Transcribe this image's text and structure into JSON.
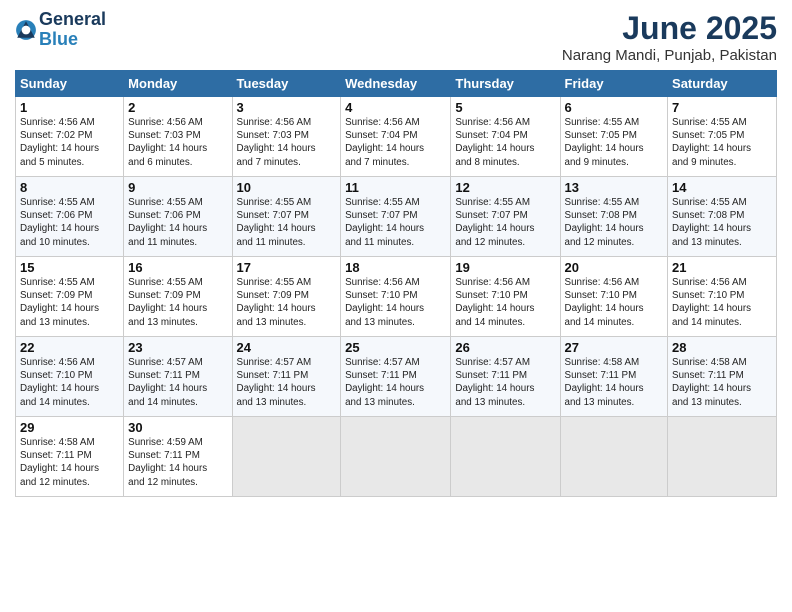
{
  "logo": {
    "line1": "General",
    "line2": "Blue"
  },
  "title": "June 2025",
  "subtitle": "Narang Mandi, Punjab, Pakistan",
  "header_days": [
    "Sunday",
    "Monday",
    "Tuesday",
    "Wednesday",
    "Thursday",
    "Friday",
    "Saturday"
  ],
  "weeks": [
    [
      {
        "day": "1",
        "text": "Sunrise: 4:56 AM\nSunset: 7:02 PM\nDaylight: 14 hours\nand 5 minutes."
      },
      {
        "day": "2",
        "text": "Sunrise: 4:56 AM\nSunset: 7:03 PM\nDaylight: 14 hours\nand 6 minutes."
      },
      {
        "day": "3",
        "text": "Sunrise: 4:56 AM\nSunset: 7:03 PM\nDaylight: 14 hours\nand 7 minutes."
      },
      {
        "day": "4",
        "text": "Sunrise: 4:56 AM\nSunset: 7:04 PM\nDaylight: 14 hours\nand 7 minutes."
      },
      {
        "day": "5",
        "text": "Sunrise: 4:56 AM\nSunset: 7:04 PM\nDaylight: 14 hours\nand 8 minutes."
      },
      {
        "day": "6",
        "text": "Sunrise: 4:55 AM\nSunset: 7:05 PM\nDaylight: 14 hours\nand 9 minutes."
      },
      {
        "day": "7",
        "text": "Sunrise: 4:55 AM\nSunset: 7:05 PM\nDaylight: 14 hours\nand 9 minutes."
      }
    ],
    [
      {
        "day": "8",
        "text": "Sunrise: 4:55 AM\nSunset: 7:06 PM\nDaylight: 14 hours\nand 10 minutes."
      },
      {
        "day": "9",
        "text": "Sunrise: 4:55 AM\nSunset: 7:06 PM\nDaylight: 14 hours\nand 11 minutes."
      },
      {
        "day": "10",
        "text": "Sunrise: 4:55 AM\nSunset: 7:07 PM\nDaylight: 14 hours\nand 11 minutes."
      },
      {
        "day": "11",
        "text": "Sunrise: 4:55 AM\nSunset: 7:07 PM\nDaylight: 14 hours\nand 11 minutes."
      },
      {
        "day": "12",
        "text": "Sunrise: 4:55 AM\nSunset: 7:07 PM\nDaylight: 14 hours\nand 12 minutes."
      },
      {
        "day": "13",
        "text": "Sunrise: 4:55 AM\nSunset: 7:08 PM\nDaylight: 14 hours\nand 12 minutes."
      },
      {
        "day": "14",
        "text": "Sunrise: 4:55 AM\nSunset: 7:08 PM\nDaylight: 14 hours\nand 13 minutes."
      }
    ],
    [
      {
        "day": "15",
        "text": "Sunrise: 4:55 AM\nSunset: 7:09 PM\nDaylight: 14 hours\nand 13 minutes."
      },
      {
        "day": "16",
        "text": "Sunrise: 4:55 AM\nSunset: 7:09 PM\nDaylight: 14 hours\nand 13 minutes."
      },
      {
        "day": "17",
        "text": "Sunrise: 4:55 AM\nSunset: 7:09 PM\nDaylight: 14 hours\nand 13 minutes."
      },
      {
        "day": "18",
        "text": "Sunrise: 4:56 AM\nSunset: 7:10 PM\nDaylight: 14 hours\nand 13 minutes."
      },
      {
        "day": "19",
        "text": "Sunrise: 4:56 AM\nSunset: 7:10 PM\nDaylight: 14 hours\nand 14 minutes."
      },
      {
        "day": "20",
        "text": "Sunrise: 4:56 AM\nSunset: 7:10 PM\nDaylight: 14 hours\nand 14 minutes."
      },
      {
        "day": "21",
        "text": "Sunrise: 4:56 AM\nSunset: 7:10 PM\nDaylight: 14 hours\nand 14 minutes."
      }
    ],
    [
      {
        "day": "22",
        "text": "Sunrise: 4:56 AM\nSunset: 7:10 PM\nDaylight: 14 hours\nand 14 minutes."
      },
      {
        "day": "23",
        "text": "Sunrise: 4:57 AM\nSunset: 7:11 PM\nDaylight: 14 hours\nand 14 minutes."
      },
      {
        "day": "24",
        "text": "Sunrise: 4:57 AM\nSunset: 7:11 PM\nDaylight: 14 hours\nand 13 minutes."
      },
      {
        "day": "25",
        "text": "Sunrise: 4:57 AM\nSunset: 7:11 PM\nDaylight: 14 hours\nand 13 minutes."
      },
      {
        "day": "26",
        "text": "Sunrise: 4:57 AM\nSunset: 7:11 PM\nDaylight: 14 hours\nand 13 minutes."
      },
      {
        "day": "27",
        "text": "Sunrise: 4:58 AM\nSunset: 7:11 PM\nDaylight: 14 hours\nand 13 minutes."
      },
      {
        "day": "28",
        "text": "Sunrise: 4:58 AM\nSunset: 7:11 PM\nDaylight: 14 hours\nand 13 minutes."
      }
    ],
    [
      {
        "day": "29",
        "text": "Sunrise: 4:58 AM\nSunset: 7:11 PM\nDaylight: 14 hours\nand 12 minutes."
      },
      {
        "day": "30",
        "text": "Sunrise: 4:59 AM\nSunset: 7:11 PM\nDaylight: 14 hours\nand 12 minutes."
      },
      {
        "day": "",
        "text": ""
      },
      {
        "day": "",
        "text": ""
      },
      {
        "day": "",
        "text": ""
      },
      {
        "day": "",
        "text": ""
      },
      {
        "day": "",
        "text": ""
      }
    ]
  ]
}
